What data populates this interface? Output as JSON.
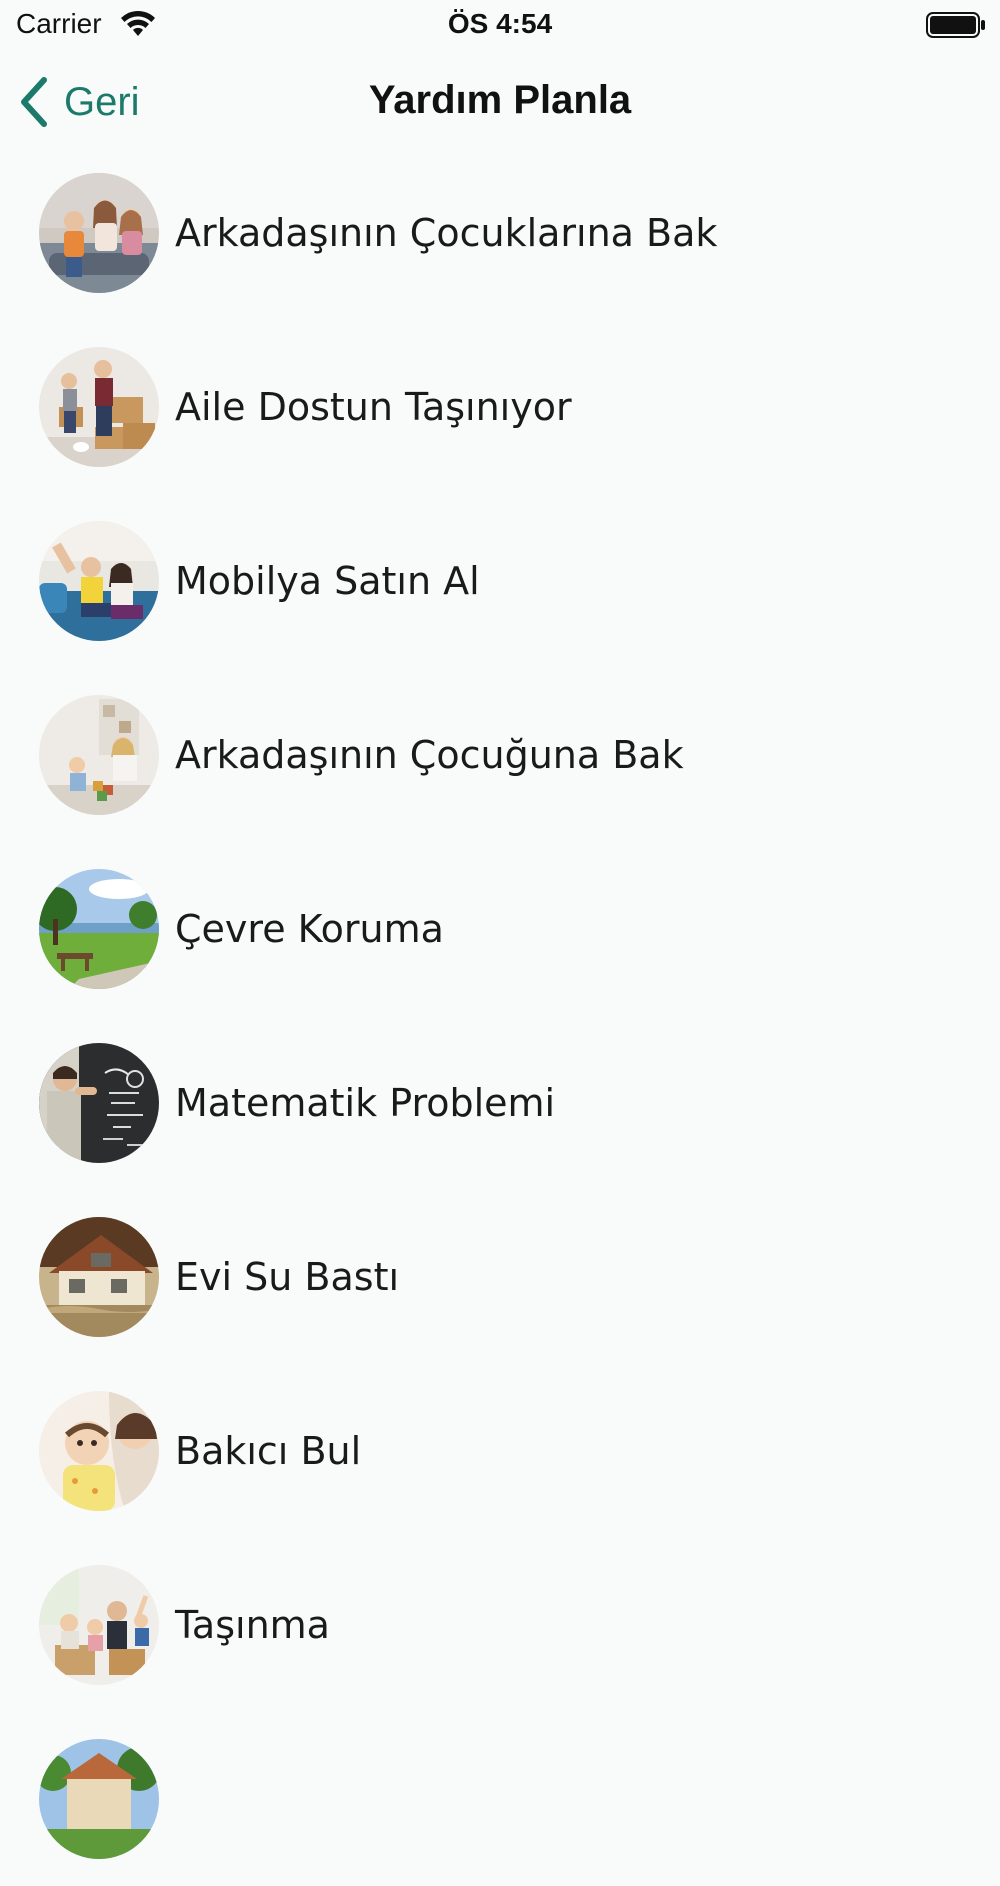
{
  "status_bar": {
    "carrier": "Carrier",
    "time": "ÖS 4:54"
  },
  "nav": {
    "back_label": "Geri",
    "title": "Yardım Planla"
  },
  "items": [
    {
      "label": "Arkadaşının Çocuklarına Bak",
      "image": "children-on-couch-photo"
    },
    {
      "label": "Aile Dostun Taşınıyor",
      "image": "family-moving-boxes-photo"
    },
    {
      "label": "Mobilya Satın Al",
      "image": "couple-on-sofa-photo"
    },
    {
      "label": "Arkadaşının Çocuğuna Bak",
      "image": "mother-child-playing-photo"
    },
    {
      "label": "Çevre Koruma",
      "image": "park-lake-photo"
    },
    {
      "label": "Matematik Problemi",
      "image": "teacher-chalkboard-photo"
    },
    {
      "label": "Evi Su Bastı",
      "image": "flooded-house-photo"
    },
    {
      "label": "Bakıcı Bul",
      "image": "baby-and-caregiver-photo"
    },
    {
      "label": "Taşınma",
      "image": "family-moving-photo"
    },
    {
      "label": "",
      "image": "house-photo"
    }
  ],
  "colors": {
    "accent": "#1b7a6a",
    "background": "#f9fbfa",
    "text": "#1a1a1a"
  }
}
